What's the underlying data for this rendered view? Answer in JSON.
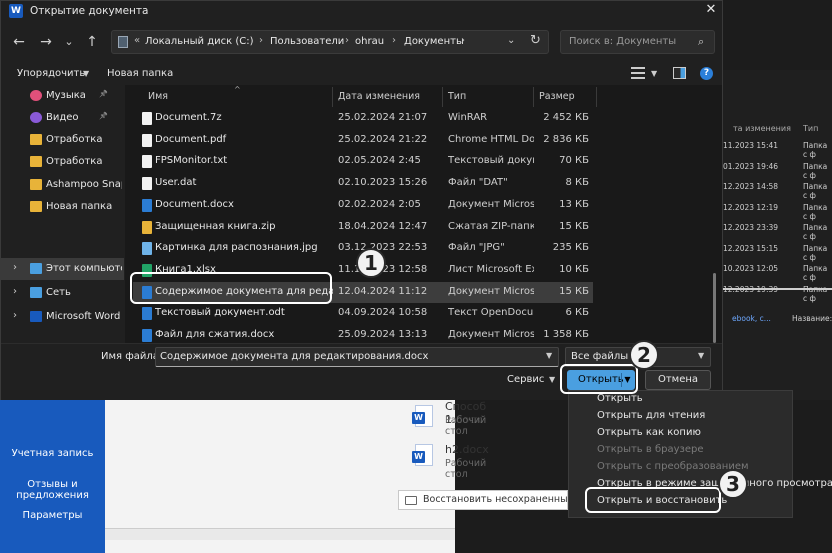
{
  "dialog": {
    "title": "Открытие документа",
    "close": "✕"
  },
  "nav_buttons": {
    "back": "←",
    "forward": "→",
    "dropdown": "⌄",
    "up": "↑"
  },
  "address": {
    "prefix": "«",
    "crumbs": [
      "Локальный диск (C:)",
      "Пользователи",
      "ohrau",
      "Документы"
    ],
    "sep": "›"
  },
  "search": {
    "placeholder": "Поиск в: Документы"
  },
  "toolbar": {
    "organize": "Упорядочить",
    "new_folder": "Новая папка",
    "help": "?"
  },
  "nav_pane": [
    {
      "label": "Музыка",
      "icon": "music-icon",
      "pinned": true
    },
    {
      "label": "Видео",
      "icon": "video-icon",
      "pinned": true
    },
    {
      "label": "Отработка",
      "icon": "folder-icon",
      "pinned": false
    },
    {
      "label": "Отработка",
      "icon": "folder-icon",
      "pinned": false
    },
    {
      "label": "Ashampoo Snap",
      "icon": "folder-icon",
      "pinned": false
    },
    {
      "label": "Новая папка",
      "icon": "folder-icon",
      "pinned": false
    },
    {
      "label": "Этот компьютер",
      "icon": "computer-icon",
      "expandable": true
    },
    {
      "label": "Сеть",
      "icon": "network-icon",
      "expandable": true
    },
    {
      "label": "Microsoft Word",
      "icon": "word-icon",
      "expandable": true
    }
  ],
  "columns": {
    "name": "Имя",
    "date": "Дата изменения",
    "type": "Тип",
    "size": "Размер"
  },
  "files": [
    {
      "name": "Document.7z",
      "date": "25.02.2024 21:07",
      "type": "WinRAR",
      "size": "2 452 КБ",
      "icon": "archive-icon",
      "color": "#f2f2f2"
    },
    {
      "name": "Document.pdf",
      "date": "25.02.2024 21:22",
      "type": "Chrome HTML Do...",
      "size": "2 836 КБ",
      "icon": "pdf-icon",
      "color": "#f2f2f2"
    },
    {
      "name": "FPSMonitor.txt",
      "date": "02.05.2024 2:45",
      "type": "Текстовый докум...",
      "size": "70 КБ",
      "icon": "text-file-icon",
      "color": "#f2f2f2"
    },
    {
      "name": "User.dat",
      "date": "02.10.2023 15:26",
      "type": "Файл \"DAT\"",
      "size": "8 КБ",
      "icon": "file-icon",
      "color": "#f2f2f2"
    },
    {
      "name": "Document.docx",
      "date": "02.02.2024 2:05",
      "type": "Документ Micros...",
      "size": "13 КБ",
      "icon": "word-doc-icon",
      "color": "#2b7cd3"
    },
    {
      "name": "Защищенная книга.zip",
      "date": "18.04.2024 12:47",
      "type": "Сжатая ZIP-папка",
      "size": "15 КБ",
      "icon": "zip-icon",
      "color": "#e8b339"
    },
    {
      "name": "Картинка для распознания.jpg",
      "date": "03.12.2023 22:53",
      "type": "Файл \"JPG\"",
      "size": "235 КБ",
      "icon": "image-icon",
      "color": "#6fb3e8"
    },
    {
      "name": "Книга1.xlsx",
      "date": "11.12.2023 12:58",
      "type": "Лист Microsoft Ex...",
      "size": "10 КБ",
      "icon": "excel-icon",
      "color": "#21a366"
    },
    {
      "name": "Содержимое документа для редактиро...",
      "date": "12.04.2024 11:12",
      "type": "Документ Micros...",
      "size": "15 КБ",
      "icon": "word-doc-icon",
      "color": "#2b7cd3",
      "selected": true
    },
    {
      "name": "Текстовый документ.odt",
      "date": "04.09.2024 10:58",
      "type": "Текст OpenDocu...",
      "size": "6 КБ",
      "icon": "odt-icon",
      "color": "#2b7cd3"
    },
    {
      "name": "Файл для сжатия.docx",
      "date": "25.09.2024 13:13",
      "type": "Документ Micros...",
      "size": "1 358 КБ",
      "icon": "word-doc-icon",
      "color": "#2b7cd3"
    }
  ],
  "bottom": {
    "filename_label": "Имя файла:",
    "filename_value": "Содержимое документа для редактирования.docx",
    "filter_value": "Все файлы (*.*)",
    "service": "Сервис",
    "open": "Открыть",
    "cancel": "Отмена"
  },
  "open_menu": [
    {
      "label": "Открыть",
      "disabled": false
    },
    {
      "label": "Открыть для чтения",
      "disabled": false
    },
    {
      "label": "Открыть как копию",
      "disabled": false
    },
    {
      "label": "Открыть в браузере",
      "disabled": true
    },
    {
      "label": "Открыть с преобразованием",
      "disabled": true
    },
    {
      "label": "Открыть в режиме защищенного просмотра",
      "disabled": false
    },
    {
      "label": "Открыть и восстановить",
      "disabled": false
    }
  ],
  "callouts": [
    "1",
    "2",
    "3"
  ],
  "background_app": {
    "left_menu": [
      "Учетная запись",
      "Отзывы и предложения",
      "Параметры"
    ],
    "recent_docs": [
      {
        "name": "Способ 1.docx",
        "location": "Рабочий стол"
      },
      {
        "name": "h2.docx",
        "location": "Рабочий стол"
      }
    ],
    "restore_button": "Восстановить несохраненные доку..."
  },
  "background_explorer": {
    "col_date": "та изменения",
    "col_type": "Тип",
    "rows": [
      {
        "date": "11.2023 15:41",
        "type": "Папка с ф"
      },
      {
        "date": "01.2023 19:46",
        "type": "Папка с ф"
      },
      {
        "date": "12.2023 14:58",
        "type": "Папка с ф"
      },
      {
        "date": "12.2023 12:19",
        "type": "Папка с ф"
      },
      {
        "date": "12.2023 23:39",
        "type": "Папка с ф"
      },
      {
        "date": "12.2023 15:15",
        "type": "Папка с ф"
      },
      {
        "date": "10.2023 12:05",
        "type": "Папка с ф"
      },
      {
        "date": "12.2023 19:39",
        "type": "Папка с ф"
      }
    ],
    "bottom_left": "ebook, c...",
    "bottom_right": "Название:"
  }
}
